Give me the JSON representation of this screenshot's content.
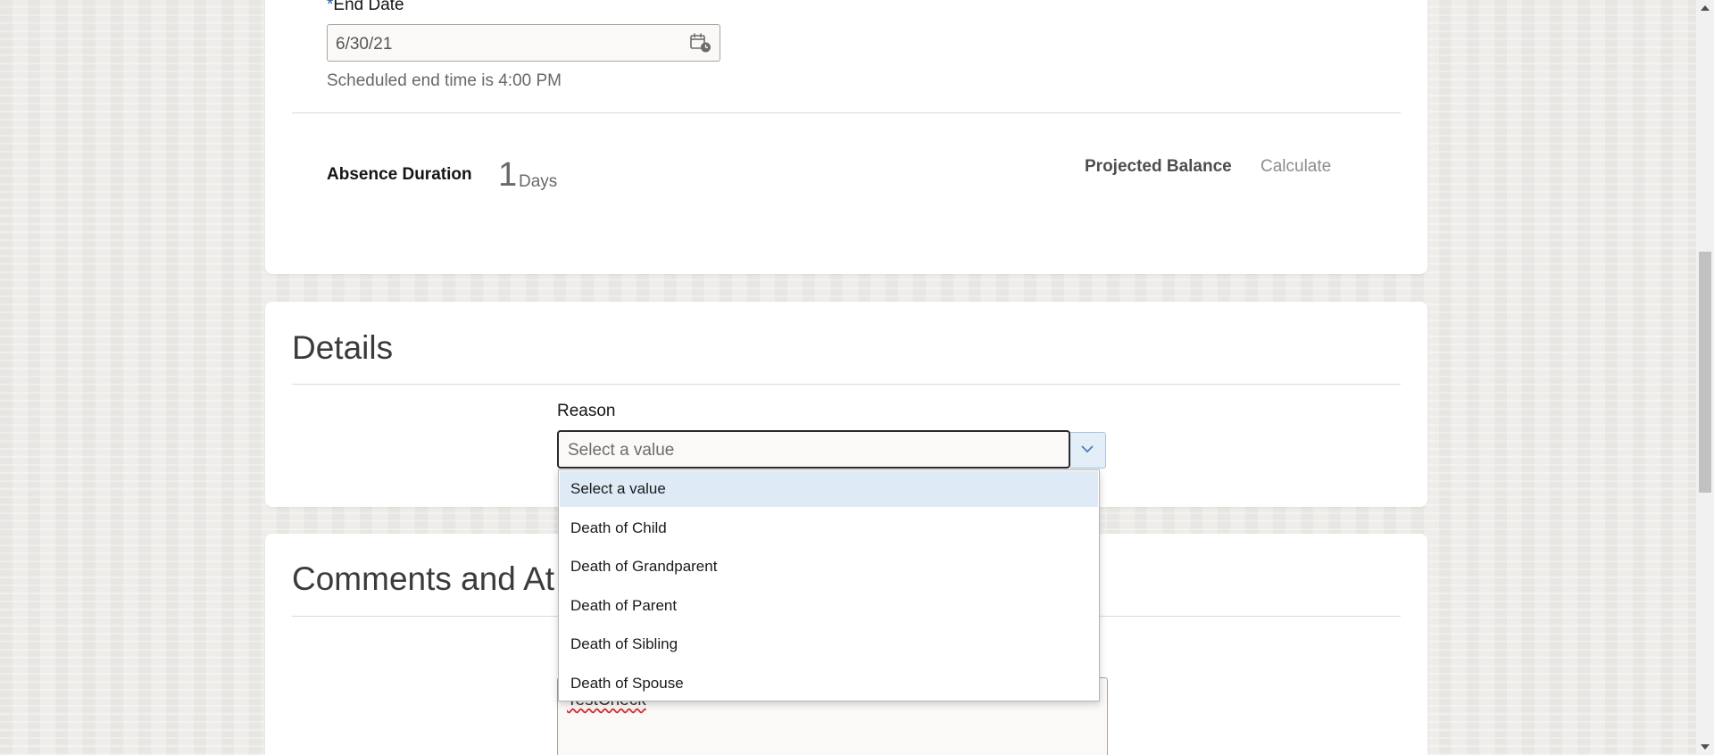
{
  "end_date": {
    "required_marker": "*",
    "label": "End Date",
    "value": "6/30/21",
    "hint": "Scheduled end time is 4:00 PM"
  },
  "duration": {
    "label": "Absence Duration",
    "value": "1",
    "unit": "Days"
  },
  "balance": {
    "label": "Projected Balance",
    "action": "Calculate"
  },
  "details": {
    "title": "Details",
    "reason_label": "Reason",
    "reason_placeholder": "Select a value"
  },
  "reason_options": [
    "Select a value",
    "Death of Child",
    "Death of Grandparent",
    "Death of Parent",
    "Death of Sibling",
    "Death of Spouse"
  ],
  "comments": {
    "title": "Comments and At",
    "text_value": "TestCheck"
  },
  "icons": {
    "date_picker": "calendar-clock-icon",
    "select_toggle": "chevron-down-icon"
  },
  "colors": {
    "required": "#1a5fa8",
    "highlight": "#deebf7"
  }
}
